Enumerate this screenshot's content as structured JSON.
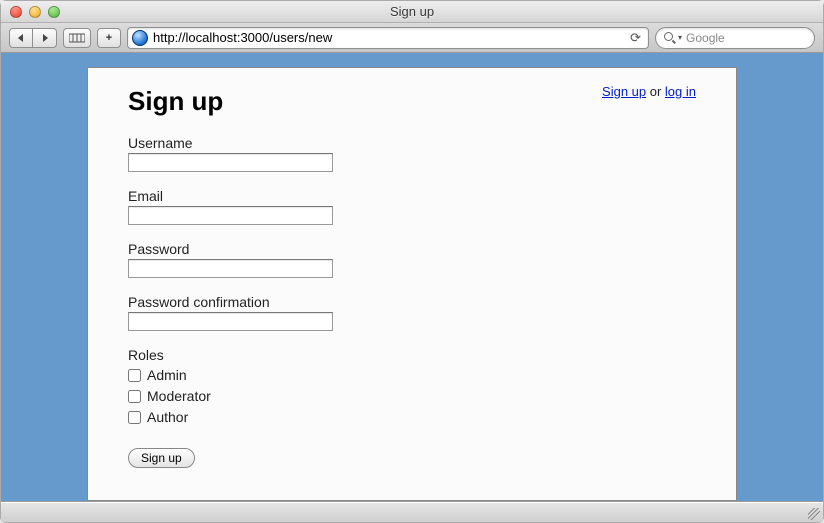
{
  "window": {
    "title": "Sign up"
  },
  "toolbar": {
    "url": "http://localhost:3000/users/new",
    "plus": "+",
    "search_placeholder": "Google"
  },
  "header": {
    "signup_link": "Sign up",
    "or_text": " or ",
    "login_link": "log in"
  },
  "form": {
    "heading": "Sign up",
    "username": {
      "label": "Username",
      "value": ""
    },
    "email": {
      "label": "Email",
      "value": ""
    },
    "password": {
      "label": "Password",
      "value": ""
    },
    "password_confirmation": {
      "label": "Password confirmation",
      "value": ""
    },
    "roles": {
      "label": "Roles",
      "items": [
        {
          "label": "Admin",
          "checked": false
        },
        {
          "label": "Moderator",
          "checked": false
        },
        {
          "label": "Author",
          "checked": false
        }
      ]
    },
    "submit": "Sign up"
  }
}
